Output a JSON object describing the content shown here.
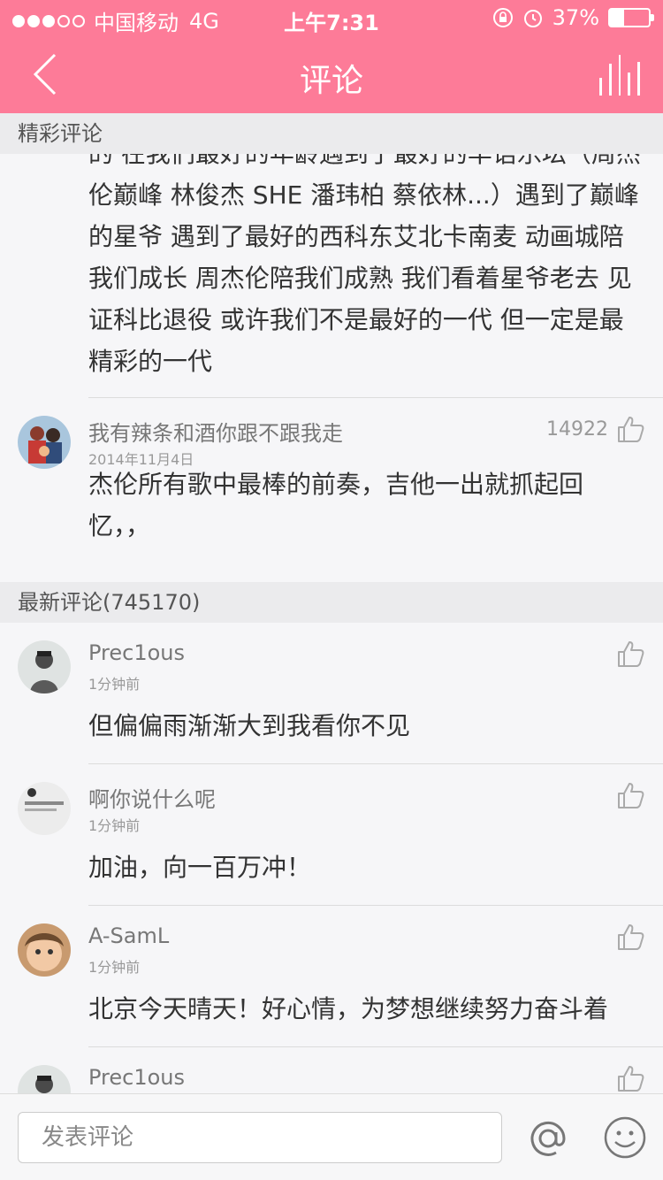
{
  "status_bar": {
    "carrier": "中国移动",
    "network": "4G",
    "time": "上午7:31",
    "battery": "37%",
    "battery_level": 0.37
  },
  "nav": {
    "title": "评论"
  },
  "sections": {
    "featured": "精彩评论",
    "latest": "最新评论(745170)"
  },
  "featured_comments": {
    "first_text": "的 在我们最好的年龄遇到了最好的华语乐坛（周杰伦巅峰 林俊杰 SHE  潘玮柏 蔡依林...）遇到了巅峰的星爷 遇到了最好的西科东艾北卡南麦 动画城陪我们成长 周杰伦陪我们成熟 我们看着星爷老去 见证科比退役 或许我们不是最好的一代 但一定是最精彩的一代",
    "second": {
      "username": "我有辣条和酒你跟不跟我走",
      "date": "2014年11月4日",
      "likes": "14922",
      "text": "杰伦所有歌中最棒的前奏，吉他一出就抓起回忆，，"
    }
  },
  "latest_comments": [
    {
      "username": "Prec1ous",
      "time": "1分钟前",
      "text": "但偏偏雨渐渐大到我看你不见"
    },
    {
      "username": "啊你说什么呢",
      "time": "1分钟前",
      "text": "加油，向一百万冲！"
    },
    {
      "username": "A-SamL",
      "time": "1分钟前",
      "text": "北京今天晴天！好心情，为梦想继续努力奋斗着"
    },
    {
      "username": "Prec1ous",
      "time": "",
      "text": ""
    }
  ],
  "bottom_bar": {
    "placeholder": "发表评论"
  },
  "colors": {
    "accent": "#fd7b98",
    "section_bg": "#ebebed",
    "background": "#f6f6f8"
  },
  "icons": [
    "back-arrow-icon",
    "bars-icon",
    "thumb-up-icon",
    "at-icon",
    "smile-icon"
  ]
}
